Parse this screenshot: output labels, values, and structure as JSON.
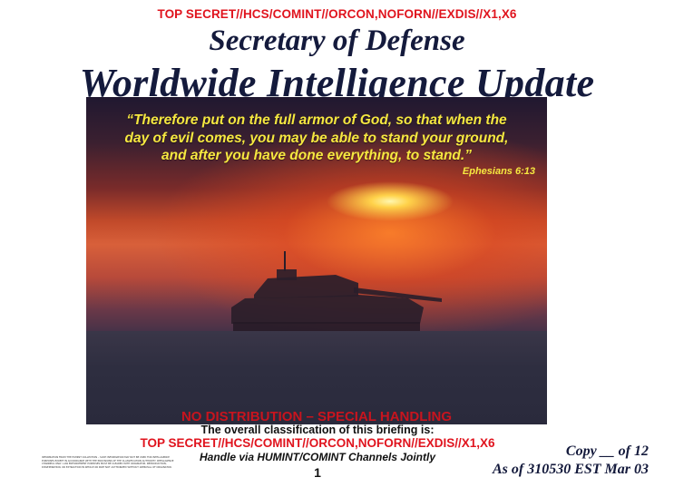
{
  "header": {
    "classification": "TOP SECRET//HCS/COMINT//ORCON,NOFORN//EXDIS//X1,X6",
    "title_line1": "Secretary of Defense",
    "title_line2": "Worldwide Intelligence Update"
  },
  "photo": {
    "quote_lines": [
      "“Therefore put on the full armor of God, so that when the",
      "day of evil comes, you may be able to stand your ground,",
      "and after you have done everything, to stand.”"
    ],
    "citation": "Ephesians 6:13"
  },
  "footer": {
    "distribution": "NO DISTRIBUTION – SPECIAL HANDLING",
    "overall_label": "The overall classification of this briefing is:",
    "classification": "TOP SECRET//HCS/COMINT//ORCON,NOFORN//EXDIS//X1,X6",
    "handling": "Handle via HUMINT/COMINT Channels Jointly",
    "page_number": "1",
    "copy": "Copy __ of 12",
    "as_of": "As of 310530 EST Mar 03",
    "fine_print": "Information from the HUMINT collection – such information may not be used for intelligence purposes except in accordance with the provisions of the classification authority. Intelligence channels only; law enforcement purposes must be cleared with originator. Reproduction, dissemination, or extraction in whole or part not authorized without approval of originator."
  },
  "colors": {
    "classification_red": "#e0141e",
    "title_navy": "#141a3c",
    "quote_yellow": "#f6e840"
  }
}
